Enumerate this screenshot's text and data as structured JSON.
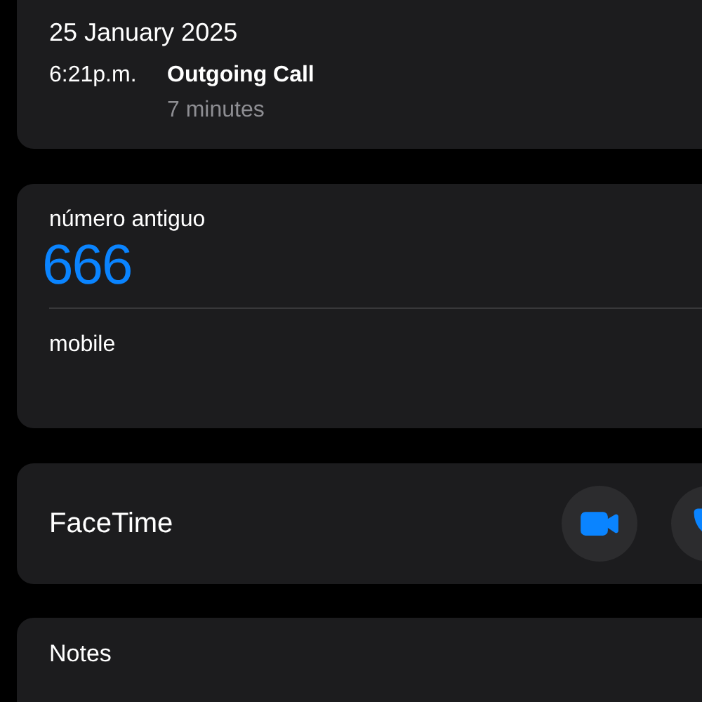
{
  "call_log": {
    "date": "25 January 2025",
    "time": "6:21p.m.",
    "type": "Outgoing Call",
    "duration": "7 minutes"
  },
  "phone": {
    "label": "número antiguo",
    "number": "666"
  },
  "secondary": {
    "label": "mobile"
  },
  "facetime": {
    "label": "FaceTime",
    "actions": [
      {
        "kind": "video"
      },
      {
        "kind": "audio"
      }
    ]
  },
  "notes": {
    "label": "Notes"
  }
}
